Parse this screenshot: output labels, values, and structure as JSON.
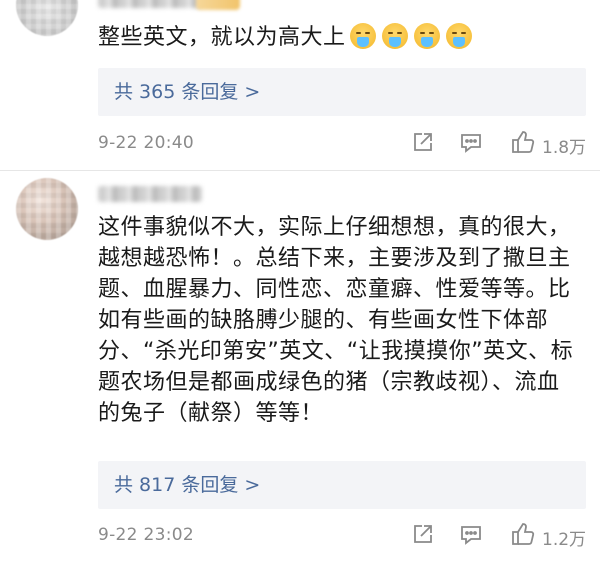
{
  "comments": [
    {
      "text_main": "整些英文，就以为高大上",
      "emoji_icons": [
        "fearful-face-icon",
        "fearful-face-icon",
        "fearful-face-icon",
        "fearful-face-icon"
      ],
      "reply_link": "共 365 条回复 >",
      "time": "9-22 20:40",
      "likes": "1.8万"
    },
    {
      "text_main": "这件事貌似不大，实际上仔细想想，真的很大，\n越想越恐怖！。总结下来，主要涉及到了撒旦主\n题、血腥暴力、同性恋、恋童癖、性爱等等。比\n如有些画的缺胳膊少腿的、有些画女性下体部\n分、“杀光印第安”英文、“让我摸摸你”英文、标\n题农场但是都画成绿色的猪（宗教歧视）、流血\n的兔子（献祭）等等！",
      "reply_link": "共 817 条回复 >",
      "time": "9-22 23:02",
      "likes": "1.2万"
    }
  ],
  "icons": {
    "share": "share-icon",
    "comment": "comment-icon",
    "like": "like-icon"
  },
  "colors": {
    "link": "#4a6a9b",
    "meta": "#8a8a8a",
    "reply_bg": "#f3f4f7"
  }
}
